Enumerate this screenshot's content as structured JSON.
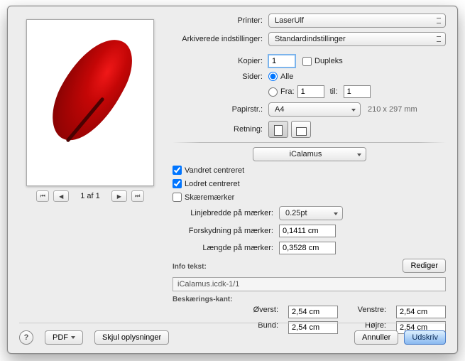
{
  "printer": {
    "label": "Printer:",
    "value": "LaserUlf"
  },
  "presets": {
    "label": "Arkiverede indstillinger:",
    "value": "Standardindstillinger"
  },
  "copies": {
    "label": "Kopier:",
    "value": "1",
    "duplex_label": "Dupleks"
  },
  "pages": {
    "label": "Sider:",
    "all_label": "Alle",
    "from_label": "Fra:",
    "to_label": "til:",
    "from_value": "1",
    "to_value": "1"
  },
  "paper": {
    "label": "Papirstr.:",
    "value": "A4",
    "dims": "210 x 297 mm"
  },
  "orientation": {
    "label": "Retning:"
  },
  "section_select": "iCalamus",
  "center_h": {
    "label": "Vandret centreret",
    "checked": true
  },
  "center_v": {
    "label": "Lodret centreret",
    "checked": true
  },
  "cropmarks": {
    "label": "Skæremærker",
    "checked": false
  },
  "line_width": {
    "label": "Linjebredde på mærker:",
    "value": "0.25pt"
  },
  "offset": {
    "label": "Forskydning på mærker:",
    "value": "0,1411 cm"
  },
  "length": {
    "label": "Længde på mærker:",
    "value": "0,3528 cm"
  },
  "info_text": {
    "label": "Info tekst:",
    "edit": "Rediger",
    "value": "iCalamus.icdk-1/1"
  },
  "crop_edge": {
    "head": "Beskærings-kant:",
    "top_label": "Øverst:",
    "top": "2,54 cm",
    "bottom_label": "Bund:",
    "bottom": "2,54 cm",
    "left_label": "Venstre:",
    "left": "2,54 cm",
    "right_label": "Højre:",
    "right": "2,54 cm"
  },
  "preview": {
    "counter": "1 af 1"
  },
  "footer": {
    "pdf": "PDF",
    "hide": "Skjul oplysninger",
    "cancel": "Annuller",
    "print": "Udskriv"
  }
}
